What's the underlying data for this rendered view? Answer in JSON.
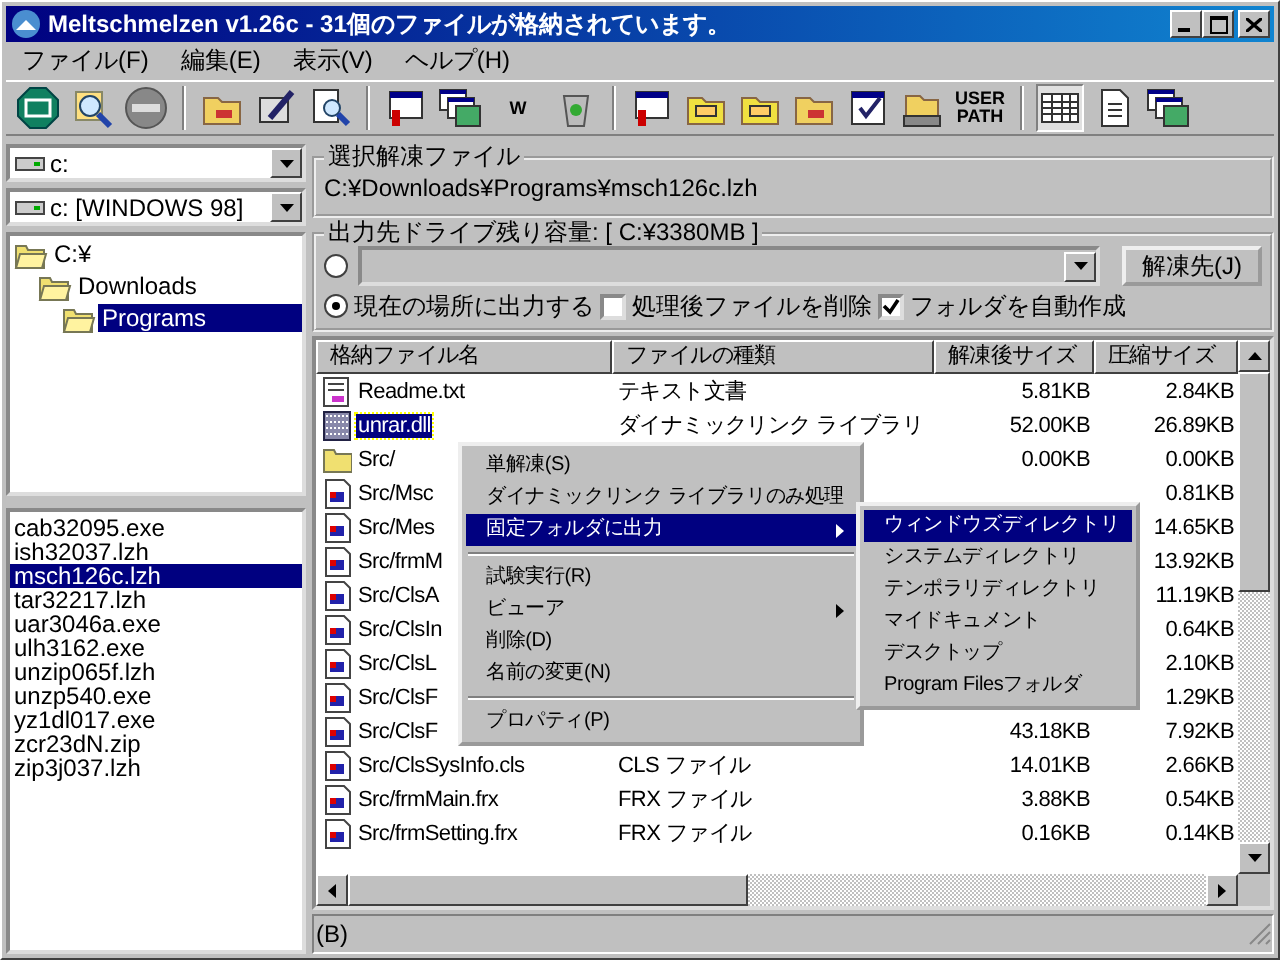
{
  "window": {
    "title": "Meltschmelzen v1.26c - 31個のファイルが格納されています。"
  },
  "menu": [
    "ファイル(F)",
    "編集(E)",
    "表示(V)",
    "ヘルプ(H)"
  ],
  "toolbar": [
    [
      {
        "kind": "exit",
        "pressed": false
      },
      {
        "kind": "magnifier",
        "pressed": false
      },
      {
        "kind": "stop",
        "pressed": false
      }
    ],
    [
      {
        "kind": "folder",
        "pressed": false
      },
      {
        "kind": "pen",
        "pressed": false
      },
      {
        "kind": "docsearch",
        "pressed": false
      }
    ],
    [
      {
        "kind": "window",
        "pressed": false
      },
      {
        "kind": "windows",
        "pressed": false
      },
      {
        "kind": "text",
        "label": "W",
        "pressed": false
      },
      {
        "kind": "bin",
        "pressed": false
      }
    ],
    [
      {
        "kind": "window",
        "pressed": false
      },
      {
        "kind": "tagfolder",
        "pressed": false
      },
      {
        "kind": "tagfolder",
        "pressed": false
      },
      {
        "kind": "folder",
        "pressed": false
      },
      {
        "kind": "checkwin",
        "pressed": false
      },
      {
        "kind": "drivefolder",
        "pressed": false
      },
      {
        "kind": "text",
        "label": "USER PATH",
        "pressed": false
      }
    ],
    [
      {
        "kind": "grid",
        "pressed": true
      },
      {
        "kind": "document",
        "pressed": false
      },
      {
        "kind": "windows",
        "pressed": false
      }
    ]
  ],
  "drive_combo": {
    "value": "c:"
  },
  "volume_combo": {
    "value": "c: [WINDOWS 98]"
  },
  "folder_tree": [
    {
      "label": "C:¥",
      "selected": false,
      "children": [
        {
          "label": "Downloads",
          "selected": false,
          "children": [
            {
              "label": "Programs",
              "selected": true
            }
          ]
        }
      ]
    }
  ],
  "archive_list": [
    {
      "name": "cab32095.exe",
      "selected": false
    },
    {
      "name": "ish32037.lzh",
      "selected": false
    },
    {
      "name": "msch126c.lzh",
      "selected": true
    },
    {
      "name": "tar32217.lzh",
      "selected": false
    },
    {
      "name": "uar3046a.exe",
      "selected": false
    },
    {
      "name": "ulh3162.exe",
      "selected": false
    },
    {
      "name": "unzip065f.lzh",
      "selected": false
    },
    {
      "name": "unzp540.exe",
      "selected": false
    },
    {
      "name": "yz1dl017.exe",
      "selected": false
    },
    {
      "name": "zcr23dN.zip",
      "selected": false
    },
    {
      "name": "zip3j037.lzh",
      "selected": false
    }
  ],
  "selected_file": {
    "title": "選択解凍ファイル",
    "path": "C:¥Downloads¥Programs¥msch126c.lzh"
  },
  "output": {
    "title": "出力先ドライブ残り容量: [ C:¥3380MB ]",
    "custom_selected": false,
    "current_label": "現在の場所に出力する",
    "current_selected": true,
    "button": "解凍先(J)",
    "checkboxes": [
      {
        "label": "処理後ファイルを削除",
        "checked": false
      },
      {
        "label": "フォルダを自動作成",
        "checked": true
      }
    ]
  },
  "table": {
    "columns": [
      "格納ファイル名",
      "ファイルの種類",
      "解凍後サイズ",
      "圧縮サイズ"
    ],
    "rows": [
      {
        "kind": "text",
        "name": "Readme.txt",
        "type": "テキスト文書",
        "size": "5.81KB",
        "packed": "2.84KB",
        "selected": false
      },
      {
        "kind": "dll",
        "name": "unrar.dll",
        "type": "ダイナミックリンク ライブラリ",
        "size": "52.00KB",
        "packed": "26.89KB",
        "selected": true
      },
      {
        "kind": "folder",
        "name": "Src/",
        "size": "0.00KB",
        "packed": "0.00KB",
        "selected": false
      },
      {
        "kind": "script",
        "name": "Src/Msc",
        "packed": "0.81KB",
        "selected": false
      },
      {
        "kind": "script",
        "name": "Src/Mes",
        "packed": "14.65KB",
        "selected": false
      },
      {
        "kind": "script",
        "name": "Src/frmM",
        "packed": "13.92KB",
        "selected": false
      },
      {
        "kind": "script",
        "name": "Src/ClsA",
        "packed": "11.19KB",
        "selected": false
      },
      {
        "kind": "script",
        "name": "Src/ClsIn",
        "packed": "0.64KB",
        "selected": false
      },
      {
        "kind": "script",
        "name": "Src/ClsL",
        "packed": "2.10KB",
        "selected": false
      },
      {
        "kind": "script",
        "name": "Src/ClsF",
        "packed": "1.29KB",
        "selected": false
      },
      {
        "kind": "script",
        "name": "Src/ClsF",
        "size": "43.18KB",
        "packed": "7.92KB",
        "selected": false
      },
      {
        "kind": "script",
        "name": "Src/ClsSysInfo.cls",
        "type": "CLS ファイル",
        "size": "14.01KB",
        "packed": "2.66KB",
        "selected": false
      },
      {
        "kind": "script",
        "name": "Src/frmMain.frx",
        "type": "FRX ファイル",
        "size": "3.88KB",
        "packed": "0.54KB",
        "selected": false
      },
      {
        "kind": "script",
        "name": "Src/frmSetting.frx",
        "type": "FRX ファイル",
        "size": "0.16KB",
        "packed": "0.14KB",
        "selected": false
      }
    ]
  },
  "context_menu": [
    {
      "kind": "item",
      "label": "単解凍(S)",
      "selected": false,
      "submenu": false
    },
    {
      "kind": "item",
      "label": "ダイナミックリンク ライブラリのみ処理",
      "selected": false,
      "submenu": false
    },
    {
      "kind": "item",
      "label": "固定フォルダに出力",
      "selected": true,
      "submenu": true
    },
    {
      "kind": "separator"
    },
    {
      "kind": "item",
      "label": "試験実行(R)",
      "selected": false,
      "submenu": false
    },
    {
      "kind": "item",
      "label": "ビューア",
      "selected": false,
      "submenu": true
    },
    {
      "kind": "item",
      "label": "削除(D)",
      "selected": false,
      "submenu": false
    },
    {
      "kind": "item",
      "label": "名前の変更(N)",
      "selected": false,
      "submenu": false
    },
    {
      "kind": "separator"
    },
    {
      "kind": "item",
      "label": "プロパティ(P)",
      "selected": false,
      "submenu": false
    }
  ],
  "submenu": [
    {
      "label": "ウィンドウズディレクトリ",
      "selected": true
    },
    {
      "label": "システムディレクトリ",
      "selected": false
    },
    {
      "label": "テンポラリディレクトリ",
      "selected": false
    },
    {
      "label": "マイドキュメント",
      "selected": false
    },
    {
      "label": "デスクトップ",
      "selected": false
    },
    {
      "label": "Program Filesフォルダ",
      "selected": false
    }
  ],
  "status_bar": {
    "text": "(B)"
  }
}
